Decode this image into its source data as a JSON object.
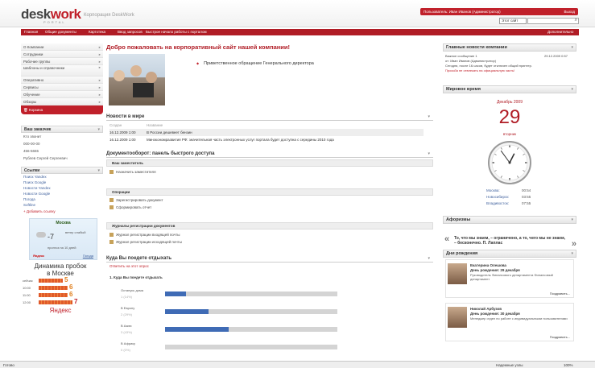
{
  "header": {
    "logo": {
      "part1": "desk",
      "part2": "work",
      "sub": "PORTAL"
    },
    "company_name": "Корпорация DeskWork",
    "user_bar": "Пользователь: Иван Иванов (Администратор)",
    "user_bar_exit": "Выход",
    "site_select": "Этот сайт",
    "nav": [
      "Главная",
      "Общие документы",
      "Картотека",
      "Ввод запросов",
      "Быстрое начало работы с порталом",
      "Дополнительно"
    ]
  },
  "left": {
    "menu": [
      {
        "label": "О Компании",
        "tall": false
      },
      {
        "label": "Сотрудники",
        "tall": false
      },
      {
        "label": "Рабочие группы",
        "tall": false
      },
      {
        "label": "Шаблоны и справочники",
        "tall": true
      },
      {
        "label": "Оперативно",
        "tall": false
      },
      {
        "label": "Сервисы",
        "tall": false
      },
      {
        "label": "Обучение",
        "tall": false
      },
      {
        "label": "Обзоры",
        "tall": false
      }
    ],
    "active_item": "Корзина",
    "contacts": {
      "title": "Ваш заказчик",
      "rows": [
        "Кто звонит",
        "000-00-00",
        "456-5665",
        "Рублев Сергей Сергеевич"
      ]
    },
    "links": {
      "title": "Ссылки",
      "items": [
        "Поиск Yandex",
        "Поиск Google",
        "Новости Yandex",
        "Новости Google",
        "Погода",
        "Softline"
      ],
      "add": "Добавить ссылку"
    },
    "weather": {
      "city": "Москва",
      "temp": "-7",
      "wind": "ветер слабый",
      "forecast": "прогноз на 10 дней",
      "provider": "Яндекс",
      "more_link": "Погода"
    },
    "traffic": {
      "title": "Динамика пробок",
      "subtitle": "в Москве",
      "footer": "Яндекс",
      "rows": [
        {
          "time": "сейчас",
          "level": 5
        },
        {
          "time": "10:00",
          "level": 6
        },
        {
          "time": "11:00",
          "level": 6
        },
        {
          "time": "12:00",
          "level": 7
        }
      ],
      "colors": {
        "bar": "#e05a2a",
        "num_low": "#e08020",
        "num_high": "#c0202a"
      }
    }
  },
  "center": {
    "welcome_title": "Добро пожаловать на корпоративный сайт нашей компании!",
    "greeting_link": "Приветственное обращение Генерального директора",
    "news": {
      "title": "Новости в мире",
      "col_date": "Создан",
      "col_title": "Название",
      "rows": [
        {
          "date": "16.12.2009 1:00",
          "title": "В России дешевеет бензин"
        },
        {
          "date": "16.12.2009 1:00",
          "title": "Минэкономразвития РФ: значительная часть электронных услуг портала будет доступна с середины 2010 года"
        }
      ]
    },
    "workflow": {
      "title": "Документооборот: панель быстрого доступа",
      "groups": [
        {
          "title": "Ваш заместитель",
          "items": [
            "Назначить заместителя"
          ]
        },
        {
          "title": "Операции",
          "items": [
            "Зарегистрировать документ",
            "Сформировать отчет"
          ]
        },
        {
          "title": "Журналы регистрации документов",
          "items": [
            "Журнал регистрации входящей почты",
            "Журнал регистрации исходящей почты"
          ]
        }
      ]
    },
    "poll": {
      "title": "Куда Вы поедете отдыхать",
      "answer_link": "Ответить на этот опрос",
      "question": "1. Куда Вы поедете отдыхать",
      "options": [
        {
          "label": "Останусь дома",
          "pct": "1 (14%)",
          "value": 0.12
        },
        {
          "label": "В Европу",
          "pct": "2 (29%)",
          "value": 0.25
        },
        {
          "label": "В Азию",
          "pct": "3 (43%)",
          "value": 0.37
        },
        {
          "label": "В Африку",
          "pct": "0 (0%)",
          "value": 0.0
        }
      ],
      "colors": {
        "fill": "#3f6bb5",
        "track": "#d4d4d4"
      }
    }
  },
  "right": {
    "news": {
      "title": "Главные новости компании",
      "item_title": "Важное сообщение 1",
      "item_date": "29.12.2009 0:57",
      "author": "от: Иван Иванов (Администратор)",
      "body": "Сегодня, после 16-часов, будет отключен общий принтер.",
      "note": "Просьба не отвлекать на официальную часть!"
    },
    "time": {
      "title": "Мировое время",
      "month": "Декабрь 2009",
      "day": "29",
      "weekday": "вторник",
      "zones": [
        {
          "city": "Москва:",
          "time": "00:54"
        },
        {
          "city": "Новосибирск:",
          "time": "03:55"
        },
        {
          "city": "Владивосток:",
          "time": "07:55"
        }
      ],
      "clock": {
        "hours": 12,
        "minutes": 54
      }
    },
    "aphorisms": {
      "title": "Афоризмы",
      "quote": "То, что мы знаем, – ограничено, а то, чего мы не знаем, – бесконечно. П. Лаплас"
    },
    "birthdays": {
      "title": "Дни рождения",
      "congrats": "Поздравить...",
      "people": [
        {
          "name": "Екатерина Олешова",
          "date": "День рождения: 29 декабря",
          "position": "Руководитель Финансового департамента Финансовый департамент"
        },
        {
          "name": "Николай Арбузов",
          "date": "День рождения: 30 декабря",
          "position": "Менеджер отдел по работе с индивидуальными пользователями"
        }
      ]
    }
  },
  "status": {
    "left": "Готово",
    "zone": "Надежные узлы",
    "zoom": "100%"
  },
  "colors": {
    "accent": "#c0202a",
    "nav": "#b01c25",
    "link": "#3d5f9c"
  }
}
